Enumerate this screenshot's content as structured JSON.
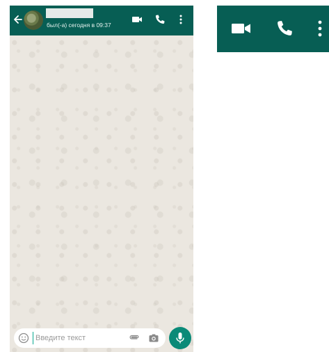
{
  "chat": {
    "contact_name": "",
    "last_seen": "был(-а) сегодня в 09:37"
  },
  "header_icons": [
    "back-arrow-icon",
    "avatar",
    "video-call-icon",
    "voice-call-icon",
    "more-options-icon"
  ],
  "input": {
    "placeholder": "Введите текст"
  },
  "composer_icons": [
    "emoji-icon",
    "attach-icon",
    "camera-icon",
    "microphone-icon"
  ],
  "zoom_panel_icons": [
    "video-call-icon",
    "voice-call-icon",
    "more-options-icon"
  ],
  "colors": {
    "header": "#075e54",
    "accent": "#0a8a78",
    "wallpaper": "#ebe7e0"
  }
}
